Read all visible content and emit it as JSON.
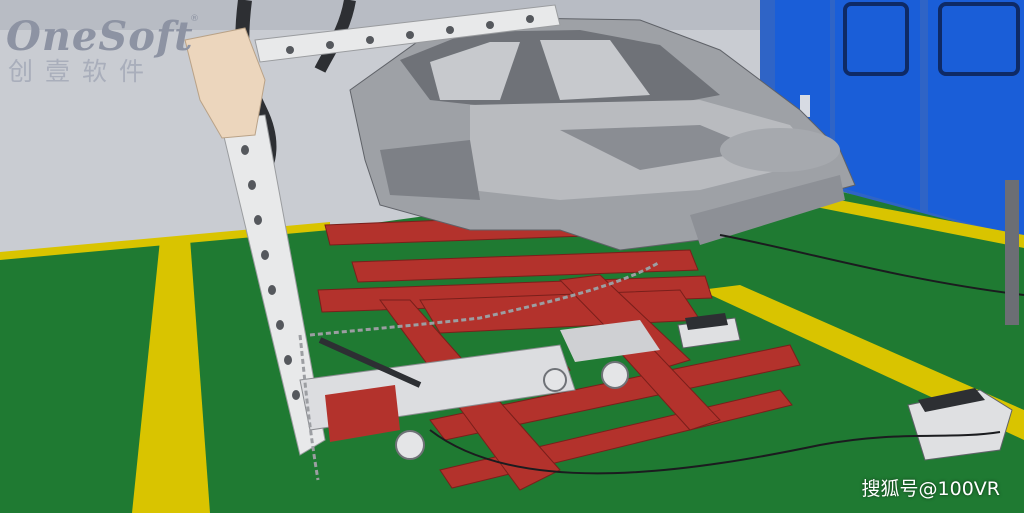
{
  "logo": {
    "name": "OneSoft",
    "chinese": "创壹软件",
    "registered": "®"
  },
  "watermark": "搜狐号@100VR",
  "colors": {
    "wall": "#c9ccd2",
    "floor_green": "#1f7a32",
    "floor_stripe": "#d9c400",
    "booth_blue": "#1a5ed8",
    "frame_red": "#b3322c",
    "body_grey": "#9ea1a6",
    "tower_white": "#e8e9ea"
  }
}
